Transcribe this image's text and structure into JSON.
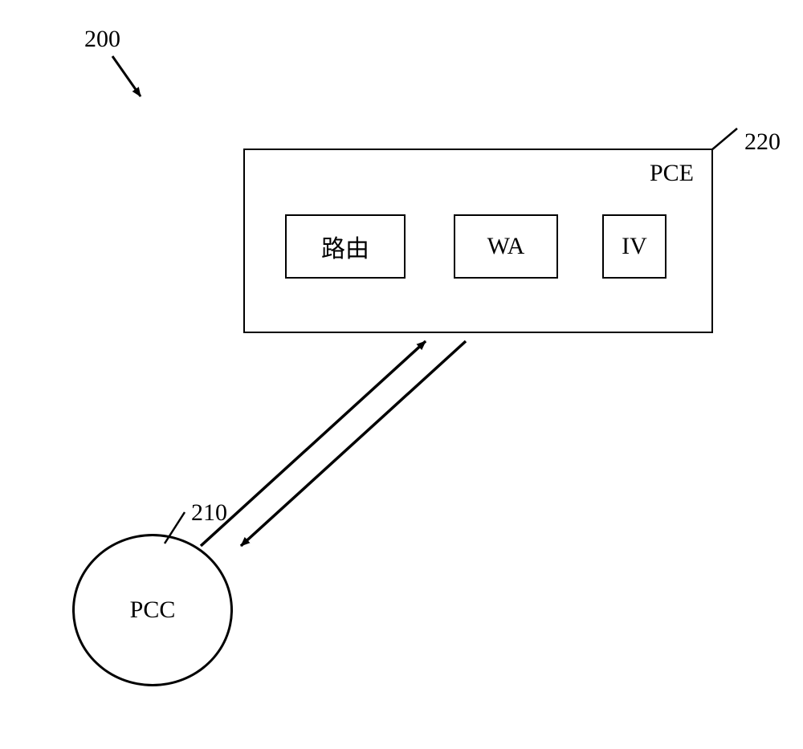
{
  "figure": {
    "ref": "200",
    "pce_ref": "220",
    "pcc_ref": "210"
  },
  "pce": {
    "title": "PCE",
    "boxes": {
      "routing": "路由",
      "wa": "WA",
      "iv": "IV"
    }
  },
  "pcc": {
    "label": "PCC"
  }
}
